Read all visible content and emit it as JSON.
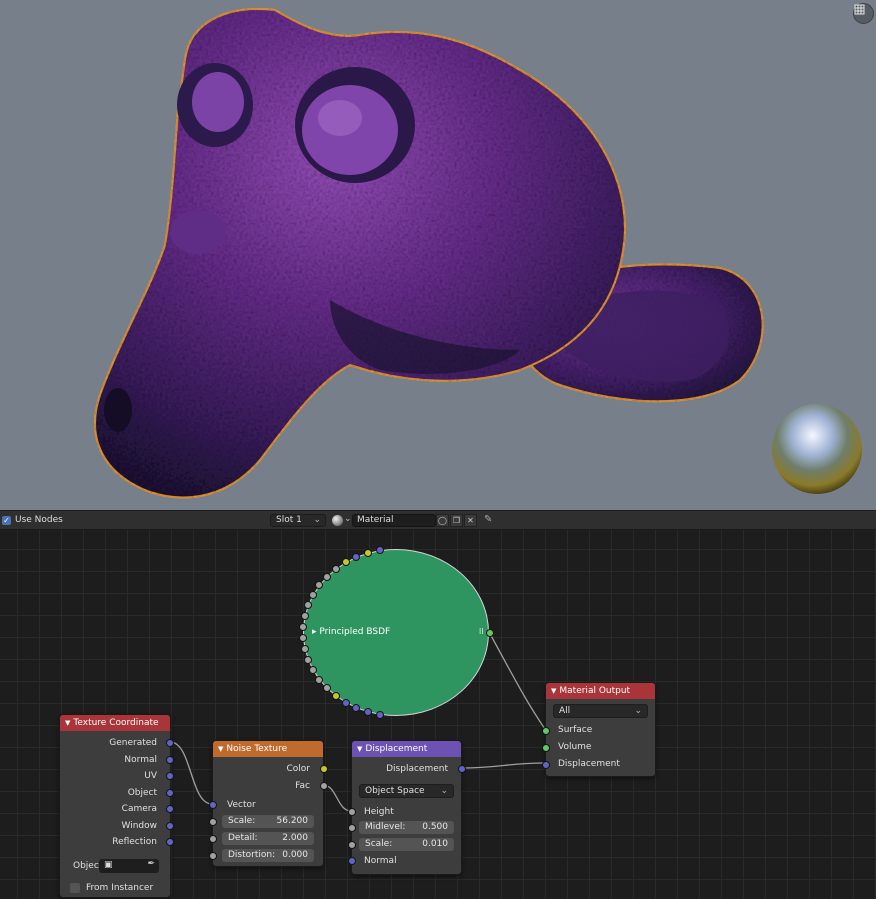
{
  "header": {
    "use_nodes_label": "Use Nodes",
    "use_nodes_checked": true,
    "slot_label": "Slot 1",
    "material_name": "Material"
  },
  "nodes": {
    "texture_coordinate": {
      "title": "Texture Coordinate",
      "outputs": [
        "Generated",
        "Normal",
        "UV",
        "Object",
        "Camera",
        "Window",
        "Reflection"
      ],
      "object_label": "Objec",
      "from_instancer_label": "From Instancer",
      "color": "#a9343a"
    },
    "noise_texture": {
      "title": "Noise Texture",
      "outputs": [
        "Color",
        "Fac"
      ],
      "vector_label": "Vector",
      "fields": [
        {
          "label": "Scale:",
          "value": "56.200"
        },
        {
          "label": "Detail:",
          "value": "2.000"
        },
        {
          "label": "Distortion:",
          "value": "0.000"
        }
      ],
      "color": "#c06a2d"
    },
    "displacement": {
      "title": "Displacement",
      "output": "Displacement",
      "space": "Object Space",
      "height_label": "Height",
      "fields": [
        {
          "label": "Midlevel:",
          "value": "0.500"
        },
        {
          "label": "Scale:",
          "value": "0.010"
        }
      ],
      "normal_label": "Normal",
      "color": "#6b52b3"
    },
    "principled_bsdf": {
      "title": "Principled BSDF",
      "color": "#2e9460"
    },
    "material_output": {
      "title": "Material Output",
      "target": "All",
      "inputs": [
        "Surface",
        "Volume",
        "Displacement"
      ],
      "color": "#a9343a"
    }
  },
  "socket_colors": {
    "vector": "#6363c7",
    "color": "#c7c729",
    "float": "#a1a1a1",
    "shader": "#63c763"
  },
  "icons": [
    "grid-view-icon",
    "material-sphere-icon",
    "shield-icon",
    "duplicate-icon",
    "close-icon",
    "pin-icon",
    "eyedropper-icon",
    "object-icon"
  ]
}
